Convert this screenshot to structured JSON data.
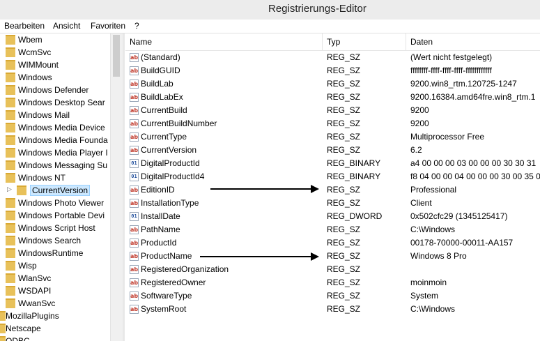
{
  "window": {
    "title": "Registrierungs-Editor"
  },
  "menu": [
    "Bearbeiten",
    "Ansicht",
    "Favoriten",
    "?"
  ],
  "tree": [
    {
      "label": "Wbem"
    },
    {
      "label": "WcmSvc"
    },
    {
      "label": "WIMMount"
    },
    {
      "label": "Windows"
    },
    {
      "label": "Windows Defender"
    },
    {
      "label": "Windows Desktop Sear"
    },
    {
      "label": "Windows Mail"
    },
    {
      "label": "Windows Media Device"
    },
    {
      "label": "Windows Media Founda"
    },
    {
      "label": "Windows Media Player I"
    },
    {
      "label": "Windows Messaging Su"
    },
    {
      "label": "Windows NT"
    },
    {
      "label": "CurrentVersion",
      "selected": true,
      "child": true
    },
    {
      "label": "Windows Photo Viewer"
    },
    {
      "label": "Windows Portable Devi"
    },
    {
      "label": "Windows Script Host"
    },
    {
      "label": "Windows Search"
    },
    {
      "label": "WindowsRuntime"
    },
    {
      "label": "Wisp"
    },
    {
      "label": "WlanSvc"
    },
    {
      "label": "WSDAPI"
    },
    {
      "label": "WwanSvc"
    },
    {
      "label": "MozillaPlugins",
      "root": true
    },
    {
      "label": "Netscape",
      "root": true
    },
    {
      "label": "ODBC",
      "root": true
    }
  ],
  "columns": {
    "name": "Name",
    "type": "Typ",
    "data": "Daten"
  },
  "values": [
    {
      "icon": "ab",
      "name": "(Standard)",
      "type": "REG_SZ",
      "data": "(Wert nicht festgelegt)"
    },
    {
      "icon": "ab",
      "name": "BuildGUID",
      "type": "REG_SZ",
      "data": "ffffffff-ffff-ffff-ffff-ffffffffffff"
    },
    {
      "icon": "ab",
      "name": "BuildLab",
      "type": "REG_SZ",
      "data": "9200.win8_rtm.120725-1247"
    },
    {
      "icon": "ab",
      "name": "BuildLabEx",
      "type": "REG_SZ",
      "data": "9200.16384.amd64fre.win8_rtm.1"
    },
    {
      "icon": "ab",
      "name": "CurrentBuild",
      "type": "REG_SZ",
      "data": "9200"
    },
    {
      "icon": "ab",
      "name": "CurrentBuildNumber",
      "type": "REG_SZ",
      "data": "9200"
    },
    {
      "icon": "ab",
      "name": "CurrentType",
      "type": "REG_SZ",
      "data": "Multiprocessor Free"
    },
    {
      "icon": "ab",
      "name": "CurrentVersion",
      "type": "REG_SZ",
      "data": "6.2"
    },
    {
      "icon": "bin",
      "name": "DigitalProductId",
      "type": "REG_BINARY",
      "data": "a4 00 00 00 03 00 00 00 30 30 31"
    },
    {
      "icon": "bin",
      "name": "DigitalProductId4",
      "type": "REG_BINARY",
      "data": "f8 04 00 00 04 00 00 00 30 00 35 0"
    },
    {
      "icon": "ab",
      "name": "EditionID",
      "type": "REG_SZ",
      "data": "Professional"
    },
    {
      "icon": "ab",
      "name": "InstallationType",
      "type": "REG_SZ",
      "data": "Client"
    },
    {
      "icon": "bin",
      "name": "InstallDate",
      "type": "REG_DWORD",
      "data": "0x502cfc29 (1345125417)"
    },
    {
      "icon": "ab",
      "name": "PathName",
      "type": "REG_SZ",
      "data": "C:\\Windows"
    },
    {
      "icon": "ab",
      "name": "ProductId",
      "type": "REG_SZ",
      "data": "00178-70000-00011-AA157"
    },
    {
      "icon": "ab",
      "name": "ProductName",
      "type": "REG_SZ",
      "data": "Windows 8 Pro"
    },
    {
      "icon": "ab",
      "name": "RegisteredOrganization",
      "type": "REG_SZ",
      "data": ""
    },
    {
      "icon": "ab",
      "name": "RegisteredOwner",
      "type": "REG_SZ",
      "data": "moinmoin"
    },
    {
      "icon": "ab",
      "name": "SoftwareType",
      "type": "REG_SZ",
      "data": "System"
    },
    {
      "icon": "ab",
      "name": "SystemRoot",
      "type": "REG_SZ",
      "data": "C:\\Windows"
    }
  ],
  "icon_names": {
    "ab": "string-value-icon",
    "bin": "binary-value-icon",
    "folder": "folder-icon"
  },
  "colors": {
    "folder": "#e8c15a",
    "selected": "#cce8ff",
    "arrow": "#000000"
  }
}
